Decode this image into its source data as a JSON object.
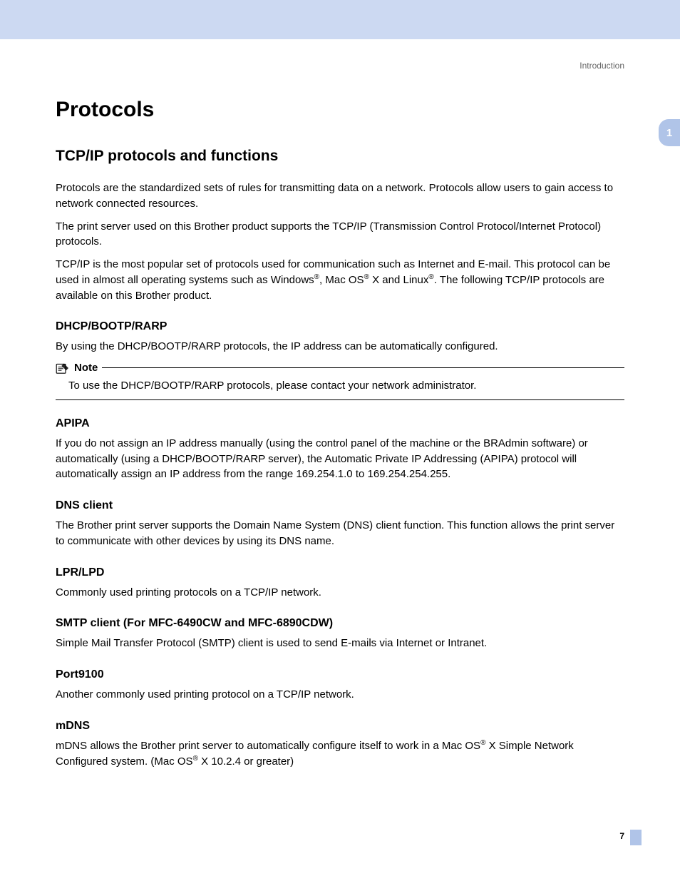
{
  "header": {
    "section": "Introduction"
  },
  "chapter_tab": "1",
  "page_number": "7",
  "h1": "Protocols",
  "h2": "TCP/IP protocols and functions",
  "intro": {
    "p1": "Protocols are the standardized sets of rules for transmitting data on a network. Protocols allow users to gain access to network connected resources.",
    "p2": "The print server used on this Brother product supports the TCP/IP (Transmission Control Protocol/Internet Protocol) protocols.",
    "p3_a": "TCP/IP is the most popular set of protocols used for communication such as Internet and E-mail. This protocol can be used in almost all operating systems such as Windows",
    "p3_b": ", Mac OS",
    "p3_c": " X and Linux",
    "p3_d": ". The following TCP/IP protocols are available on this Brother product.",
    "reg": "®"
  },
  "sections": {
    "dhcp": {
      "title": "DHCP/BOOTP/RARP",
      "body": "By using the DHCP/BOOTP/RARP protocols, the IP address can be automatically configured.",
      "note_label": "Note",
      "note_body": "To use the DHCP/BOOTP/RARP protocols, please contact your network administrator."
    },
    "apipa": {
      "title": "APIPA",
      "body": "If you do not assign an IP address manually (using the control panel of the machine or the BRAdmin software) or automatically (using a DHCP/BOOTP/RARP server), the Automatic Private IP Addressing (APIPA) protocol will automatically assign an IP address from the range 169.254.1.0 to 169.254.254.255."
    },
    "dns": {
      "title": "DNS client",
      "body": "The Brother print server supports the Domain Name System (DNS) client function. This function allows the print server to communicate with other devices by using its DNS name."
    },
    "lpr": {
      "title": "LPR/LPD",
      "body": "Commonly used printing protocols on a TCP/IP network."
    },
    "smtp": {
      "title": "SMTP client (For MFC-6490CW and MFC-6890CDW)",
      "body": "Simple Mail Transfer Protocol (SMTP) client is used to send E-mails via Internet or Intranet."
    },
    "port9100": {
      "title": "Port9100",
      "body": "Another commonly used printing protocol on a TCP/IP network."
    },
    "mdns": {
      "title": "mDNS",
      "body_a": "mDNS allows the Brother print server to automatically configure itself to work in a Mac OS",
      "body_b": " X Simple Network Configured system. (Mac OS",
      "body_c": " X 10.2.4 or greater)",
      "reg": "®"
    }
  }
}
